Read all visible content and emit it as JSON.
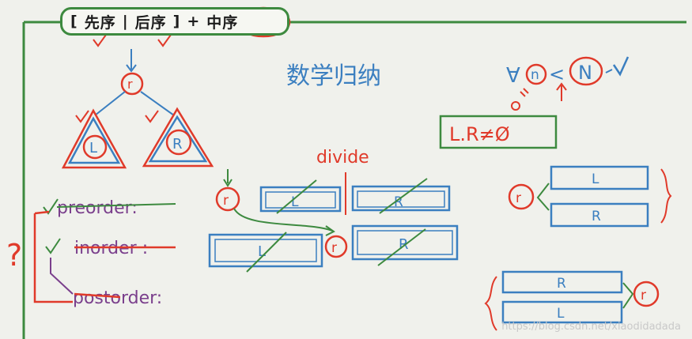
{
  "title": {
    "bracket_open": "[",
    "preorder_cn": "先序",
    "separator": "|",
    "postorder_cn": "后序",
    "bracket_close": "]",
    "plus": "+",
    "inorder_cn": "中序"
  },
  "tree": {
    "root": "r",
    "left": "L",
    "right": "R"
  },
  "induction": {
    "title": "数学归纳",
    "forall": "∀",
    "n": "n",
    "lt": "<",
    "N": "N",
    "condition": "L.R≠Ø"
  },
  "divide_label": "divide",
  "rows": {
    "preorder": "preorder:",
    "inorder": "inorder :",
    "postorder": "postorder:"
  },
  "blocks": {
    "r": "r",
    "L": "L",
    "R": "R"
  },
  "question_mark": "?",
  "watermark": "https://blog.csdn.net/xiaodidadada",
  "colors": {
    "green": "#3d8a3f",
    "red": "#e03a2a",
    "blue": "#3b7fc0",
    "purple": "#7a3f8c",
    "background": "#f0f1ec"
  }
}
